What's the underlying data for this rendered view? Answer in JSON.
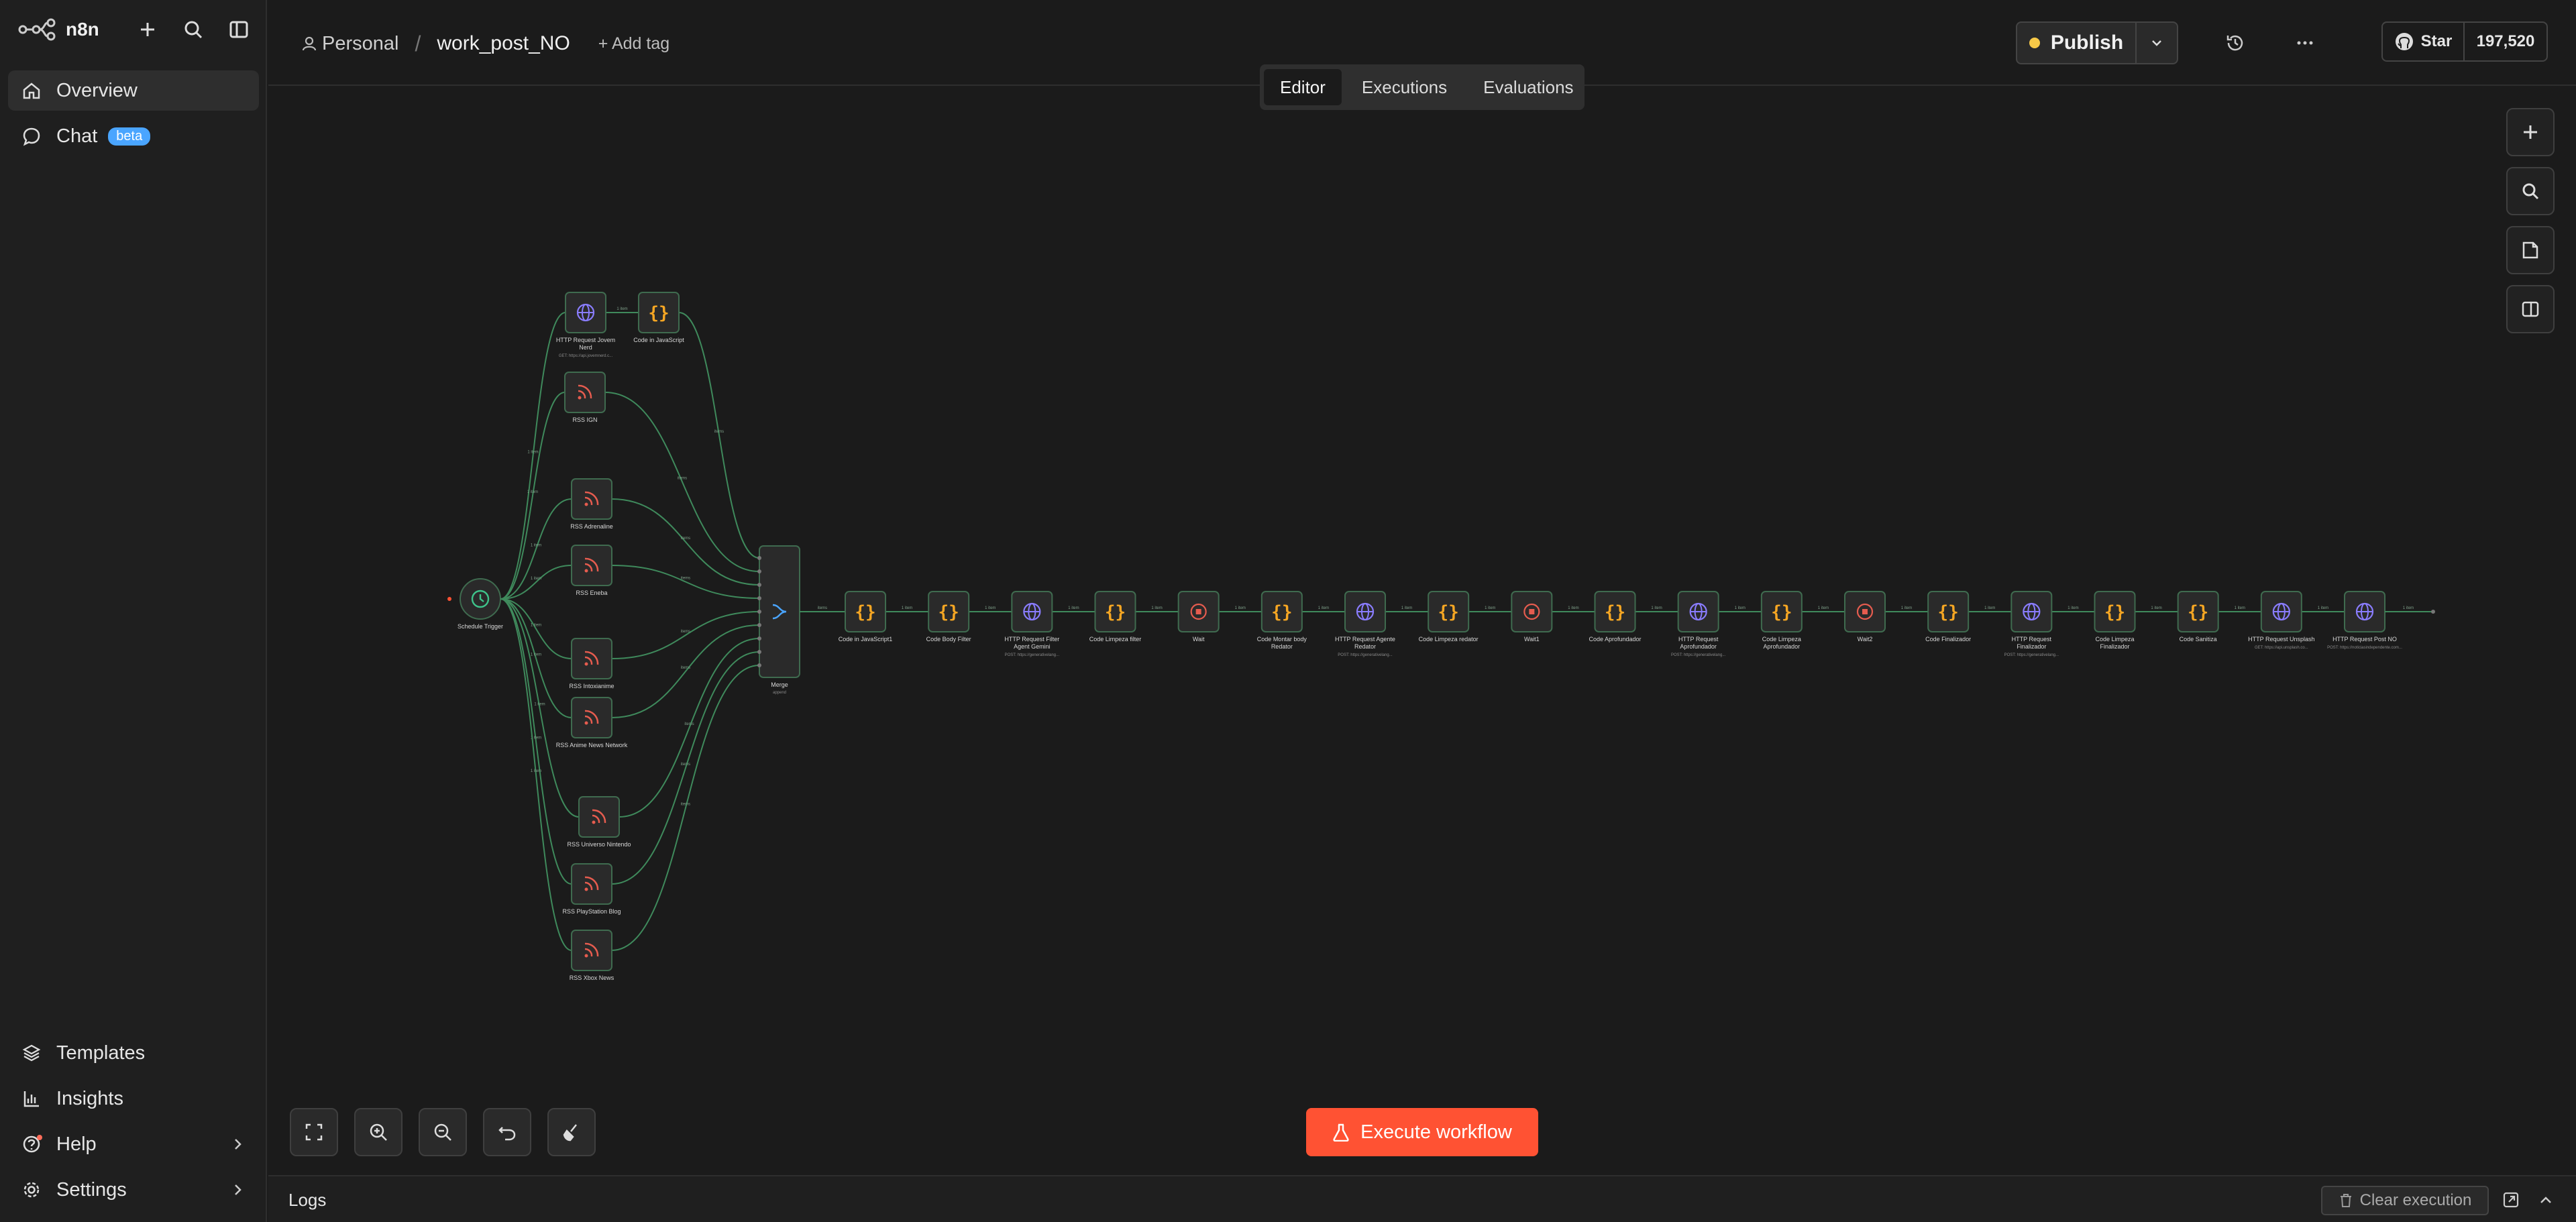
{
  "app": {
    "name": "n8n"
  },
  "sidebar": {
    "items": [
      {
        "label": "Overview",
        "icon": "home-icon",
        "active": true
      },
      {
        "label": "Chat",
        "icon": "chat-icon",
        "badge": "beta"
      }
    ],
    "bottom": [
      {
        "label": "Templates",
        "icon": "templates-icon"
      },
      {
        "label": "Insights",
        "icon": "insights-icon"
      },
      {
        "label": "Help",
        "icon": "help-icon"
      },
      {
        "label": "Settings",
        "icon": "settings-icon"
      }
    ]
  },
  "header": {
    "project": "Personal",
    "workflow_name": "work_post_NO",
    "add_tag": "+ Add tag",
    "publish": "Publish",
    "github_star": "Star",
    "github_count": "197,520",
    "tabs": [
      "Editor",
      "Executions",
      "Evaluations"
    ]
  },
  "canvas": {
    "execute_label": "Execute workflow"
  },
  "logs": {
    "title": "Logs",
    "clear": "Clear execution"
  },
  "colors": {
    "accent": "#ff5233",
    "node_border": "#3f6b4f",
    "edge": "#3f8a5c",
    "rss": "#e65c4f",
    "code": "#f5a623",
    "http": "#8a7dff"
  },
  "workflow": {
    "trigger": {
      "label": "Schedule Trigger"
    },
    "upper": [
      {
        "label": "HTTP Request Jovem Nerd",
        "type": "http",
        "sub": "GET: https://api.jovemnerd.c..."
      },
      {
        "label": "Code in JavaScript",
        "type": "code"
      }
    ],
    "rss": [
      "RSS IGN",
      "RSS Adrenaline",
      "RSS Eneba",
      "RSS Intoxianime",
      "RSS Anime News Network",
      "RSS Universo Nintendo",
      "RSS PlayStation Blog",
      "RSS Xbox News"
    ],
    "merge": {
      "label": "Merge",
      "sub": "append"
    },
    "chain": [
      {
        "label": "Code in JavaScript1",
        "type": "code"
      },
      {
        "label": "Code Body Filter",
        "type": "code"
      },
      {
        "label": "HTTP Request Filter Agent Gemini",
        "type": "http",
        "sub": "POST: https://generativelang..."
      },
      {
        "label": "Code Limpeza filter",
        "type": "code"
      },
      {
        "label": "Wait",
        "type": "wait"
      },
      {
        "label": "Code Montar body Redator",
        "type": "code"
      },
      {
        "label": "HTTP Request Agente Redator",
        "type": "http",
        "sub": "POST: https://generativelang..."
      },
      {
        "label": "Code Limpeza redator",
        "type": "code"
      },
      {
        "label": "Wait1",
        "type": "wait"
      },
      {
        "label": "Code Aprofundador",
        "type": "code"
      },
      {
        "label": "HTTP Request Aprofundador",
        "type": "http",
        "sub": "POST: https://generativelang..."
      },
      {
        "label": "Code Limpeza Aprofundador",
        "type": "code"
      },
      {
        "label": "Wait2",
        "type": "wait"
      },
      {
        "label": "Code Finalizador",
        "type": "code"
      },
      {
        "label": "HTTP Request Finalizador",
        "type": "http",
        "sub": "POST: https://generativelang..."
      },
      {
        "label": "Code Limpeza Finalizador",
        "type": "code"
      },
      {
        "label": "Code Sanitiza",
        "type": "code"
      },
      {
        "label": "HTTP Request Unsplash",
        "type": "http",
        "sub": "GET: https://api.unsplash.co..."
      },
      {
        "label": "HTTP Request Post NO",
        "type": "http",
        "sub": "POST: https://noticiasindependente.com..."
      }
    ],
    "edge_labels": {
      "item": "1 item",
      "items": "items"
    }
  }
}
